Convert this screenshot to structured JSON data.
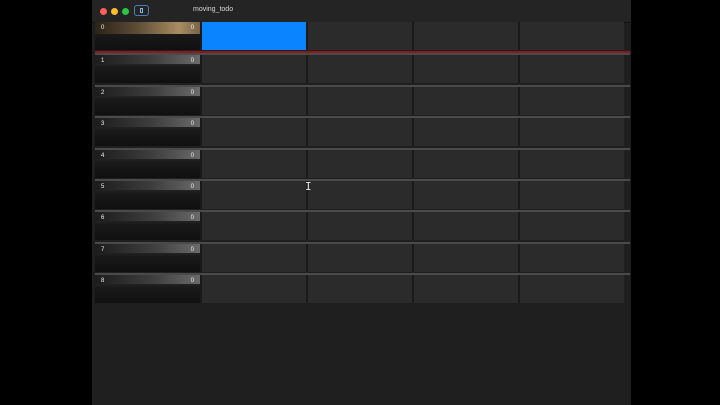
{
  "window": {
    "title": "moving_todo"
  },
  "rows": [
    {
      "index": "0",
      "count": "0"
    },
    {
      "index": "1",
      "count": "0"
    },
    {
      "index": "2",
      "count": "0"
    },
    {
      "index": "3",
      "count": "0"
    },
    {
      "index": "4",
      "count": "0"
    },
    {
      "index": "5",
      "count": "0"
    },
    {
      "index": "6",
      "count": "0"
    },
    {
      "index": "7",
      "count": "0"
    },
    {
      "index": "8",
      "count": "0"
    }
  ],
  "selection": {
    "row": 0,
    "column": 1
  },
  "colors": {
    "selected_cell": "#0a84ff",
    "row_divider": "#8b1a1a",
    "cell": "#2b2b2b"
  },
  "icons": [
    "close-button",
    "minimize-button",
    "zoom-button",
    "sidebar-toggle-icon",
    "text-cursor-icon"
  ]
}
